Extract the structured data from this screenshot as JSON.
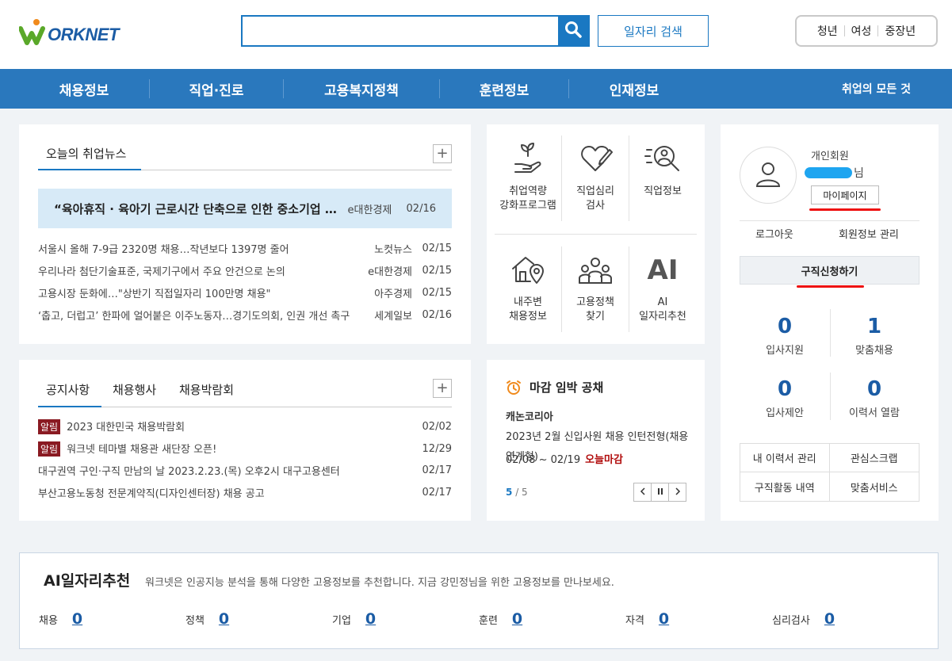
{
  "colors": {
    "brand_blue": "#1a78c2",
    "nav_blue": "#2a78bd",
    "alert_red": "#b10c0c",
    "tag_red": "#8a1a22",
    "highlight_bg": "#d7eaf7"
  },
  "header": {
    "logo_text": "ORKNET",
    "search_placeholder": "",
    "search_icon": "search-icon",
    "job_search_label": "일자리 검색",
    "audience": [
      "청년",
      "여성",
      "중장년"
    ]
  },
  "nav": {
    "items": [
      "채용정보",
      "직업·진로",
      "고용복지정책",
      "훈련정보",
      "인재정보"
    ],
    "right_label": "취업의 모든 것"
  },
  "news": {
    "tab_label": "오늘의 취업뉴스",
    "more_label": "+",
    "headline": {
      "title": "“육아휴직 · 육아기 근로시간 단축으로 인한 중소기업 대체인력 지원 확대”",
      "source": "e대한경제",
      "date": "02/16"
    },
    "items": [
      {
        "title": "서울시 올해 7-9급 2320명 채용…작년보다 1397명 줄어",
        "source": "노컷뉴스",
        "date": "02/15"
      },
      {
        "title": "우리나라 첨단기술표준, 국제기구에서 주요 안건으로 논의",
        "source": "e대한경제",
        "date": "02/15"
      },
      {
        "title": "고용시장 둔화에…\"상반기 직접일자리 100만명 채용\"",
        "source": "아주경제",
        "date": "02/15"
      },
      {
        "title": "‘춥고, 더럽고’ 한파에 얼어붙은 이주노동자…경기도의회, 인권 개선 촉구",
        "source": "세계일보",
        "date": "02/16"
      }
    ]
  },
  "notice": {
    "tabs": [
      "공지사항",
      "채용행사",
      "채용박람회"
    ],
    "more_label": "+",
    "tag_label": "알림",
    "items": [
      {
        "title": "2023 대한민국 채용박람회",
        "date": "02/02",
        "tagged": true
      },
      {
        "title": "워크넷 테마별 채용관 새단장 오픈!",
        "date": "12/29",
        "tagged": true
      },
      {
        "title": "대구권역 구인·구직 만남의 날 2023.2.23.(목) 오후2시 대구고용센터",
        "date": "02/17",
        "tagged": false
      },
      {
        "title": "부산고용노동청 전문계약직(디자인센터장) 채용 공고",
        "date": "02/17",
        "tagged": false
      }
    ]
  },
  "services": [
    {
      "label": "취업역량\n강화프로그램",
      "icon": "sprout-hand-icon"
    },
    {
      "label": "직업심리\n검사",
      "icon": "heart-pen-icon"
    },
    {
      "label": "직업정보",
      "icon": "magnifier-person-icon"
    },
    {
      "label": "내주변\n채용정보",
      "icon": "house-pin-icon"
    },
    {
      "label": "고용정책\n찾기",
      "icon": "people-group-icon"
    },
    {
      "label": "AI\n일자리추천",
      "icon": "ai-icon",
      "glyph": "AI"
    }
  ],
  "deadline": {
    "title": "마감 임박 공채",
    "company": "캐논코리아",
    "description": "2023년 2월 신입사원 채용 인턴전형(채용연계형)",
    "date_range": "02/08 ~ 02/19",
    "urgent_label": "오늘마감",
    "page_current": "5",
    "page_total": "/ 5"
  },
  "profile": {
    "member_type": "개인회원",
    "name_suffix": "님",
    "mypage_label": "마이페이지",
    "logout_label": "로그아웃",
    "manage_label": "회원정보 관리",
    "apply_label": "구직신청하기",
    "stats": [
      {
        "value": "0",
        "label": "입사지원"
      },
      {
        "value": "1",
        "label": "맞춤채용"
      },
      {
        "value": "0",
        "label": "입사제안"
      },
      {
        "value": "0",
        "label": "이력서 열람"
      }
    ],
    "quick_links": [
      "내 이력서 관리",
      "관심스크랩",
      "구직활동 내역",
      "맞춤서비스"
    ]
  },
  "ai": {
    "title": "AI일자리추천",
    "description": "워크넷은 인공지능 분석을 통해 다양한 고용정보를 추천합니다. 지금 강민정님을 위한 고용정보를 만나보세요.",
    "items": [
      {
        "label": "채용",
        "value": "0"
      },
      {
        "label": "정책",
        "value": "0"
      },
      {
        "label": "기업",
        "value": "0"
      },
      {
        "label": "훈련",
        "value": "0"
      },
      {
        "label": "자격",
        "value": "0"
      },
      {
        "label": "심리검사",
        "value": "0"
      }
    ]
  }
}
